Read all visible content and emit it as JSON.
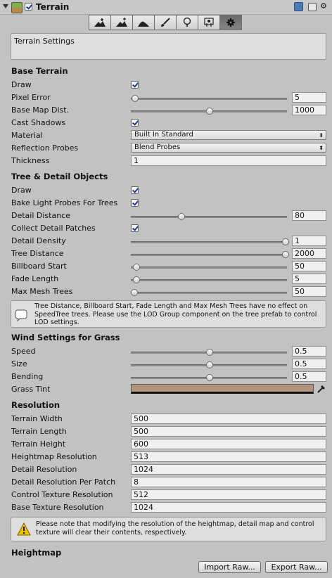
{
  "header": {
    "title": "Terrain",
    "enabled": true
  },
  "toolbar": {
    "tools": [
      "raise-lower-terrain",
      "paint-height",
      "smooth-height",
      "paint-texture",
      "place-trees",
      "paint-details",
      "terrain-settings"
    ],
    "active": "terrain-settings"
  },
  "description": "Terrain Settings",
  "base_terrain": {
    "heading": "Base Terrain",
    "draw": {
      "label": "Draw",
      "checked": true
    },
    "pixel_error": {
      "label": "Pixel Error",
      "value": "5",
      "slider": 0.03
    },
    "base_map_dist": {
      "label": "Base Map Dist.",
      "value": "1000",
      "slider": 0.5
    },
    "cast_shadows": {
      "label": "Cast Shadows",
      "checked": true
    },
    "material": {
      "label": "Material",
      "value": "Built In Standard"
    },
    "reflection_probes": {
      "label": "Reflection Probes",
      "value": "Blend Probes"
    },
    "thickness": {
      "label": "Thickness",
      "value": "1"
    }
  },
  "tree_detail": {
    "heading": "Tree & Detail Objects",
    "draw": {
      "label": "Draw",
      "checked": true
    },
    "bake_light_probes": {
      "label": "Bake Light Probes For Trees",
      "checked": true
    },
    "detail_distance": {
      "label": "Detail Distance",
      "value": "80",
      "slider": 0.32
    },
    "collect_detail_patches": {
      "label": "Collect Detail Patches",
      "checked": true
    },
    "detail_density": {
      "label": "Detail Density",
      "value": "1",
      "slider": 1.0
    },
    "tree_distance": {
      "label": "Tree Distance",
      "value": "2000",
      "slider": 1.0
    },
    "billboard_start": {
      "label": "Billboard Start",
      "value": "50",
      "slider": 0.02
    },
    "fade_length": {
      "label": "Fade Length",
      "value": "5",
      "slider": 0.02
    },
    "max_mesh_trees": {
      "label": "Max Mesh Trees",
      "value": "50",
      "slider": 0.0
    },
    "help": "Tree Distance, Billboard Start, Fade Length and Max Mesh Trees have no effect on SpeedTree trees. Please use the LOD Group component on the tree prefab to control LOD settings."
  },
  "wind": {
    "heading": "Wind Settings for Grass",
    "speed": {
      "label": "Speed",
      "value": "0.5",
      "slider": 0.5
    },
    "size": {
      "label": "Size",
      "value": "0.5",
      "slider": 0.5
    },
    "bending": {
      "label": "Bending",
      "value": "0.5",
      "slider": 0.5
    },
    "grass_tint": {
      "label": "Grass Tint",
      "color": "#b2957d"
    }
  },
  "resolution": {
    "heading": "Resolution",
    "rows": [
      {
        "label": "Terrain Width",
        "value": "500"
      },
      {
        "label": "Terrain Length",
        "value": "500"
      },
      {
        "label": "Terrain Height",
        "value": "600"
      },
      {
        "label": "Heightmap Resolution",
        "value": "513"
      },
      {
        "label": "Detail Resolution",
        "value": "1024"
      },
      {
        "label": "Detail Resolution Per Patch",
        "value": "8"
      },
      {
        "label": "Control Texture Resolution",
        "value": "512"
      },
      {
        "label": "Base Texture Resolution",
        "value": "1024"
      }
    ],
    "warning": "Please note that modifying the resolution of the heightmap, detail map and control texture will clear their contents, respectively."
  },
  "heightmap": {
    "heading": "Heightmap",
    "import_label": "Import Raw...",
    "export_label": "Export Raw..."
  }
}
